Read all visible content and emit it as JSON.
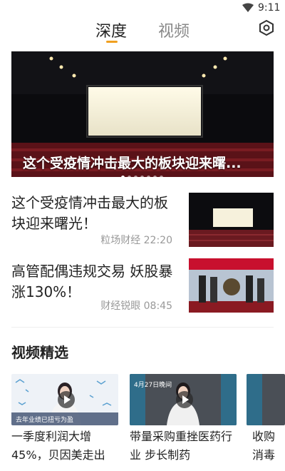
{
  "status_bar": {
    "time": "9:11"
  },
  "tabs": [
    {
      "label": "深度"
    },
    {
      "label": "视频"
    }
  ],
  "banner": {
    "caption": "这个受疫情冲击最大的板块迎来曙..."
  },
  "news": [
    {
      "title": "这个受疫情冲击最大的板块迎来曙光！",
      "meta": "粒场财经 22:20"
    },
    {
      "title": "高管配偶违规交易 妖股暴涨130%！",
      "meta": "财经锐眼 08:45"
    }
  ],
  "video_section": {
    "title": "视频精选",
    "cards": [
      {
        "title": "一季度利润大增45%，贝因美走出",
        "thumb_caption": "去年业绩已扭亏为盈"
      },
      {
        "title": "带量采购重挫医药行业 步长制药",
        "thumb_caption": "4月27日晚间"
      },
      {
        "title": "收购消毒"
      }
    ]
  },
  "colors": {
    "accent": "#f0a020",
    "muted": "#999999"
  }
}
